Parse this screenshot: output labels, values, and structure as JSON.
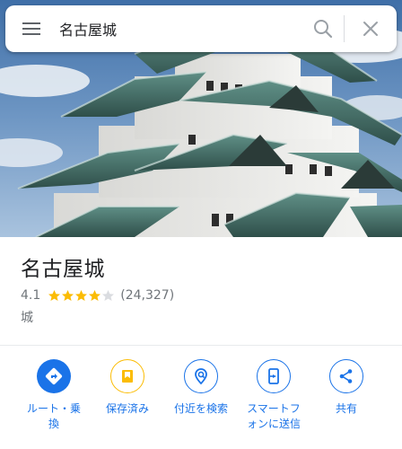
{
  "search": {
    "query": "名古屋城",
    "menu_icon": "menu-icon",
    "search_icon": "search-icon",
    "close_icon": "close-icon"
  },
  "place": {
    "name": "名古屋城",
    "rating_value": "4.1",
    "rating_stars": 4.1,
    "rating_max": 5,
    "review_count": "(24,327)",
    "category": "城"
  },
  "actions": [
    {
      "label": "ルート・乗\n換",
      "icon": "directions-icon"
    },
    {
      "label": "保存済み",
      "icon": "bookmark-icon"
    },
    {
      "label": "付近を検索",
      "icon": "nearby-search-icon"
    },
    {
      "label": "スマートフ\nォンに送信",
      "icon": "send-to-phone-icon"
    },
    {
      "label": "共有",
      "icon": "share-icon"
    }
  ],
  "colors": {
    "accent": "#1a73e8",
    "star": "#fbbc04",
    "saved": "#fbbc04",
    "text_secondary": "#70757a"
  }
}
